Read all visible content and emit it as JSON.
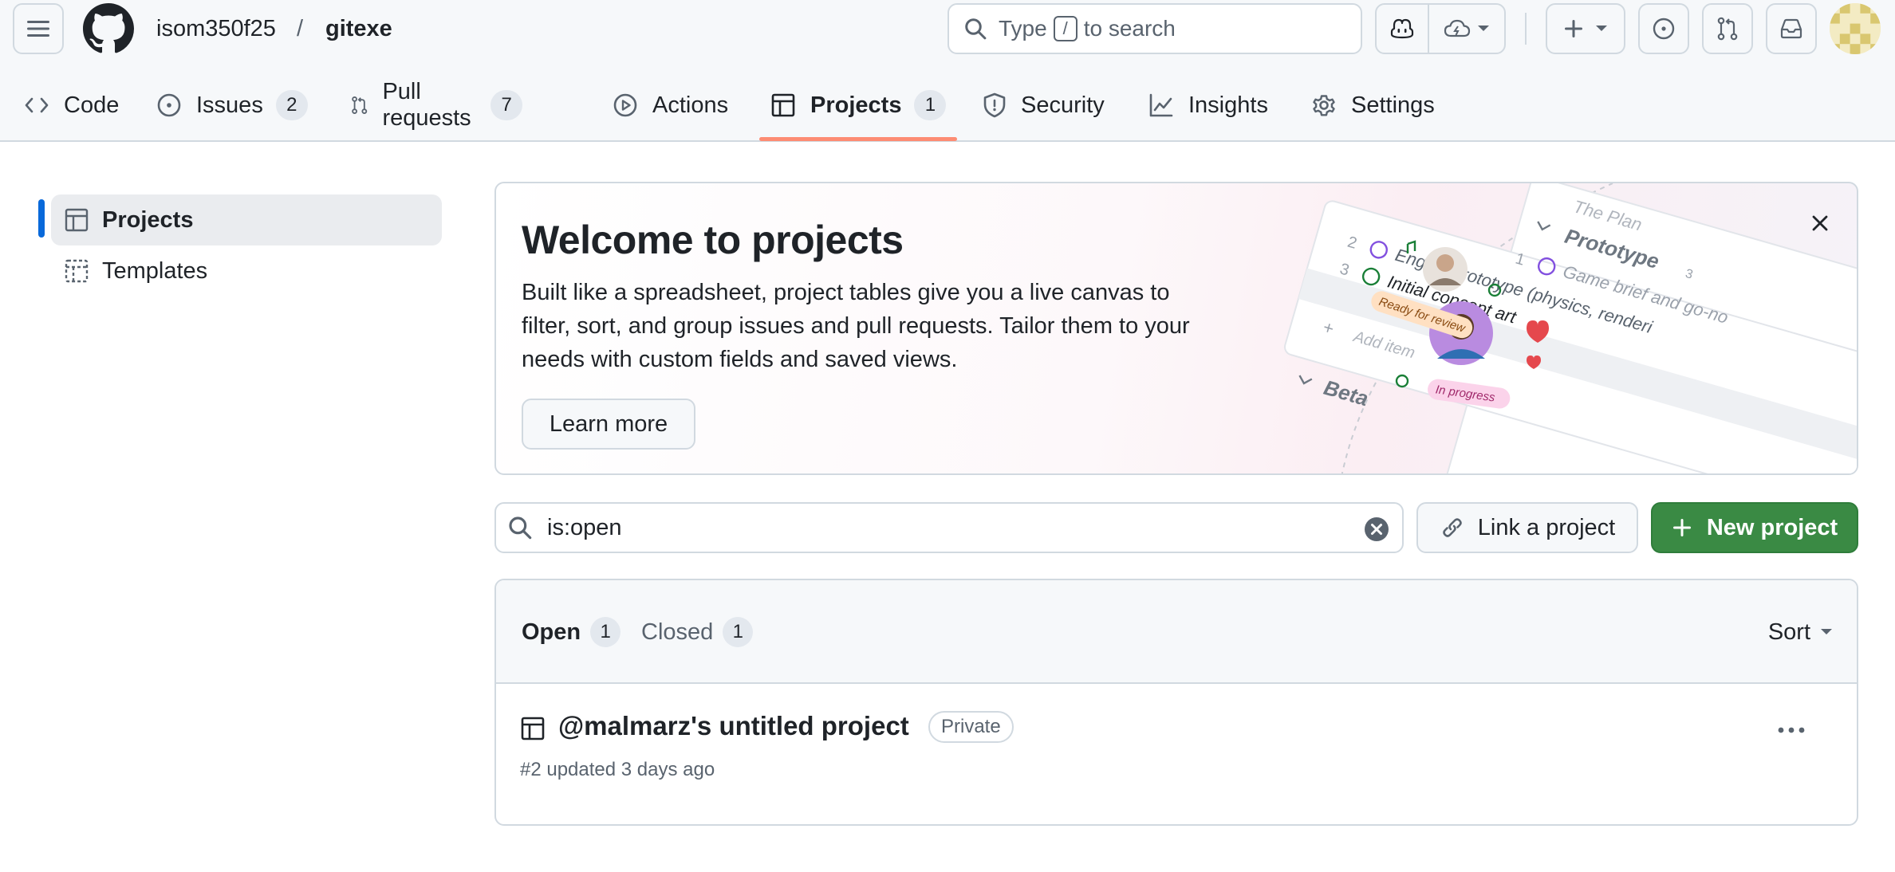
{
  "header": {
    "owner": "isom350f25",
    "separator": "/",
    "repo": "gitexe",
    "search": {
      "prefix": "Type",
      "key": "/",
      "suffix": "to search"
    }
  },
  "tabs": [
    {
      "label": "Code",
      "icon": "code-icon"
    },
    {
      "label": "Issues",
      "count": "2",
      "icon": "issue-icon"
    },
    {
      "label": "Pull requests",
      "count": "7",
      "icon": "pull-request-icon"
    },
    {
      "label": "Actions",
      "icon": "play-icon"
    },
    {
      "label": "Projects",
      "count": "1",
      "icon": "table-icon",
      "selected": true
    },
    {
      "label": "Security",
      "icon": "shield-icon"
    },
    {
      "label": "Insights",
      "icon": "graph-icon"
    },
    {
      "label": "Settings",
      "icon": "gear-icon"
    }
  ],
  "sidebar": {
    "items": [
      {
        "label": "Projects",
        "icon": "table-icon",
        "active": true
      },
      {
        "label": "Templates",
        "icon": "template-icon"
      }
    ]
  },
  "banner": {
    "title": "Welcome to projects",
    "body": "Built like a spreadsheet, project tables give you a live canvas to filter, sort, and group issues and pull requests. Tailor them to your needs with custom fields and saved views.",
    "learn_more": "Learn more",
    "art": {
      "ready_label": "Ready for review",
      "progress_label": "In progress",
      "plan_label": "The Plan",
      "group1": "Prototype",
      "group1_count": "3",
      "rows": [
        {
          "num": "1",
          "text": "Game brief and go-no"
        },
        {
          "num": "2",
          "text": "Engine prototype (physics, renderi"
        },
        {
          "num": "3",
          "text": "Initial concept art"
        }
      ],
      "add_item": "Add item",
      "group2": "Beta"
    }
  },
  "filter": {
    "value": "is:open",
    "link_button": "Link a project",
    "new_button": "New project"
  },
  "list": {
    "open_label": "Open",
    "open_count": "1",
    "closed_label": "Closed",
    "closed_count": "1",
    "sort_label": "Sort",
    "projects": [
      {
        "title": "@malmarz's untitled project",
        "visibility": "Private",
        "meta": "#2 updated 3 days ago"
      }
    ]
  },
  "colors": {
    "accent_underline": "#fd8c73",
    "primary_button": "#3a8a44",
    "selected_indicator": "#0969da"
  }
}
